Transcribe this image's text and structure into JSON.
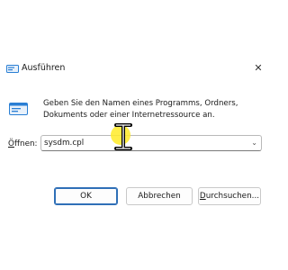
{
  "window": {
    "title": "Ausführen",
    "close_icon": "close-icon",
    "app_icon": "run-dialog-icon"
  },
  "description": {
    "line1": "Geben Sie den Namen eines Programms, Ordners,",
    "line2": "Dokuments oder einer Internetressource an."
  },
  "open_field": {
    "label_access_key": "Ö",
    "label_rest": "ffnen:",
    "value": "sysdm.cpl"
  },
  "buttons": {
    "ok": "OK",
    "cancel": "Abbrechen",
    "browse_access_key": "D",
    "browse_rest": "urchsuchen..."
  },
  "colors": {
    "accent": "#2f6fb7",
    "cursor_highlight": "#ffeb28"
  }
}
